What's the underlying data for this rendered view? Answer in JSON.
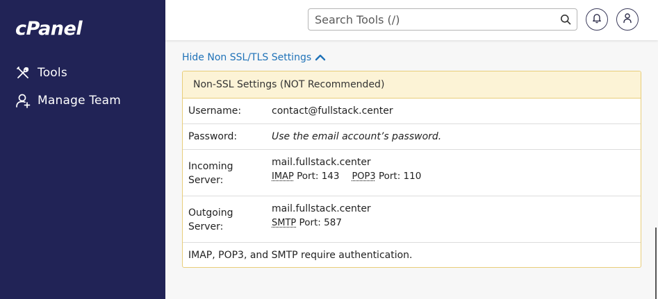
{
  "sidebar": {
    "logo": "cPanel",
    "items": [
      {
        "label": "Tools",
        "icon": "tools-icon"
      },
      {
        "label": "Manage Team",
        "icon": "user-add-icon"
      }
    ]
  },
  "topbar": {
    "search_placeholder": "Search Tools (/)",
    "search_icon": "search-icon",
    "notifications_icon": "bell-icon",
    "account_icon": "user-icon"
  },
  "settings": {
    "toggle_label": "Hide Non SSL/TLS Settings",
    "panel_title": "Non-SSL Settings (NOT Recommended)",
    "username_label": "Username:",
    "username_value": "contact@fullstack.center",
    "password_label": "Password:",
    "password_value": "Use the email account’s password.",
    "incoming_label_1": "Incoming",
    "incoming_label_2": "Server:",
    "incoming_host": "mail.fullstack.center",
    "imap_label": "IMAP",
    "imap_port": "Port: 143",
    "pop3_label": "POP3",
    "pop3_port": "Port: 110",
    "outgoing_label_1": "Outgoing",
    "outgoing_label_2": "Server:",
    "outgoing_host": "mail.fullstack.center",
    "smtp_label": "SMTP",
    "smtp_port": "Port: 587",
    "auth_note": "IMAP, POP3, and SMTP require authentication."
  },
  "colors": {
    "sidebar_bg": "#212356",
    "link": "#1f72b8",
    "warning_border": "#e8cd7a",
    "warning_bg": "#fcf3d6"
  }
}
